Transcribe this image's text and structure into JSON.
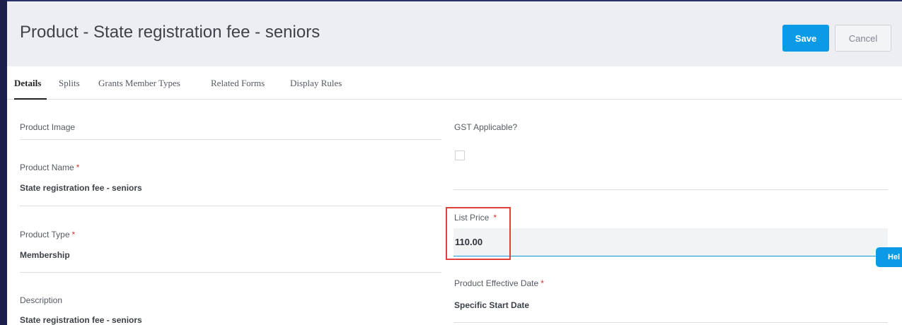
{
  "header": {
    "title": "Product - State registration fee - seniors",
    "save_label": "Save",
    "cancel_label": "Cancel"
  },
  "tabs": [
    {
      "label": "Details",
      "active": true
    },
    {
      "label": "Splits",
      "active": false
    },
    {
      "label": "Grants Member Types",
      "active": false
    },
    {
      "label": "Related Forms",
      "active": false
    },
    {
      "label": "Display Rules",
      "active": false
    }
  ],
  "left_fields": {
    "product_image": {
      "label": "Product Image"
    },
    "product_name": {
      "label": "Product Name",
      "required_mark": "*",
      "value": "State registration fee - seniors"
    },
    "product_type": {
      "label": "Product Type",
      "required_mark": "*",
      "value": "Membership"
    },
    "description": {
      "label": "Description",
      "value": "State registration fee - seniors"
    }
  },
  "right_fields": {
    "gst_applicable": {
      "label": "GST Applicable?",
      "checked": false
    },
    "list_price": {
      "label": "List Price",
      "required_mark": "*",
      "value": "110.00"
    },
    "effective_date": {
      "label": "Product Effective Date",
      "required_mark": "*",
      "value": "Specific Start Date"
    }
  },
  "help": {
    "label": "Hel"
  },
  "colors": {
    "accent": "#0a9ae6",
    "required": "#d9302b",
    "highlight": "#e2403b",
    "header_bg": "#eceef2"
  }
}
